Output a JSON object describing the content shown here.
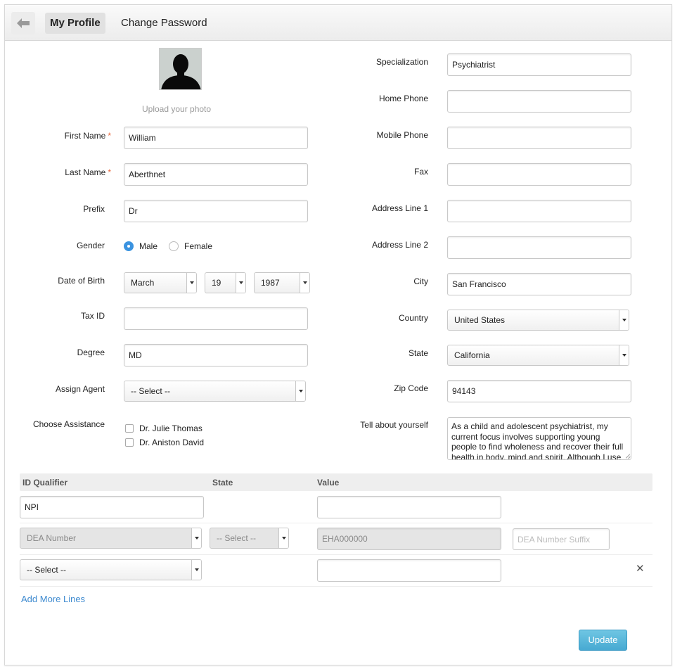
{
  "tabs": {
    "profile": "My Profile",
    "password": "Change Password"
  },
  "photo": {
    "upload_label": "Upload your photo"
  },
  "left": {
    "first_name": {
      "label": "First Name",
      "required": "*",
      "value": "William"
    },
    "last_name": {
      "label": "Last Name",
      "required": "*",
      "value": "Aberthnet"
    },
    "prefix": {
      "label": "Prefix",
      "value": "Dr"
    },
    "gender": {
      "label": "Gender",
      "options": [
        "Male",
        "Female"
      ],
      "selected": "Male"
    },
    "dob": {
      "label": "Date of Birth",
      "month": "March",
      "day": "19",
      "year": "1987"
    },
    "tax_id": {
      "label": "Tax ID",
      "value": ""
    },
    "degree": {
      "label": "Degree",
      "value": "MD"
    },
    "assign_agent": {
      "label": "Assign Agent",
      "value": "-- Select --"
    },
    "assistance": {
      "label": "Choose Assistance",
      "options": [
        "Dr. Julie Thomas",
        "Dr. Aniston David"
      ]
    }
  },
  "right": {
    "specialization": {
      "label": "Specialization",
      "value": "Psychiatrist"
    },
    "home_phone": {
      "label": "Home Phone",
      "value": ""
    },
    "mobile_phone": {
      "label": "Mobile Phone",
      "value": ""
    },
    "fax": {
      "label": "Fax",
      "value": ""
    },
    "address1": {
      "label": "Address Line 1",
      "value": ""
    },
    "address2": {
      "label": "Address Line 2",
      "value": ""
    },
    "city": {
      "label": "City",
      "value": "San Francisco"
    },
    "country": {
      "label": "Country",
      "value": "United States"
    },
    "state": {
      "label": "State",
      "value": "California"
    },
    "zip": {
      "label": "Zip Code",
      "value": "94143"
    },
    "about": {
      "label": "Tell about yourself",
      "value": "As a child and adolescent psychiatrist, my current focus involves supporting young people to find wholeness and recover their full health in body, mind and spirit. Although I use"
    }
  },
  "id_table": {
    "headers": {
      "qualifier": "ID Qualifier",
      "state": "State",
      "value": "Value"
    },
    "row1": {
      "qualifier": "NPI",
      "value": ""
    },
    "row2": {
      "qualifier": "DEA Number",
      "state": "-- Select --",
      "value": "EHA000000",
      "suffix_placeholder": "DEA Number Suffix"
    },
    "row3": {
      "qualifier": "-- Select --",
      "value": "",
      "remove": "✕"
    },
    "add_more": "Add More Lines"
  },
  "actions": {
    "update": "Update"
  },
  "colors": {
    "accent": "#3b93e0",
    "link": "#3f8bd0",
    "button": "#47a9d2",
    "required": "#e8663a"
  }
}
